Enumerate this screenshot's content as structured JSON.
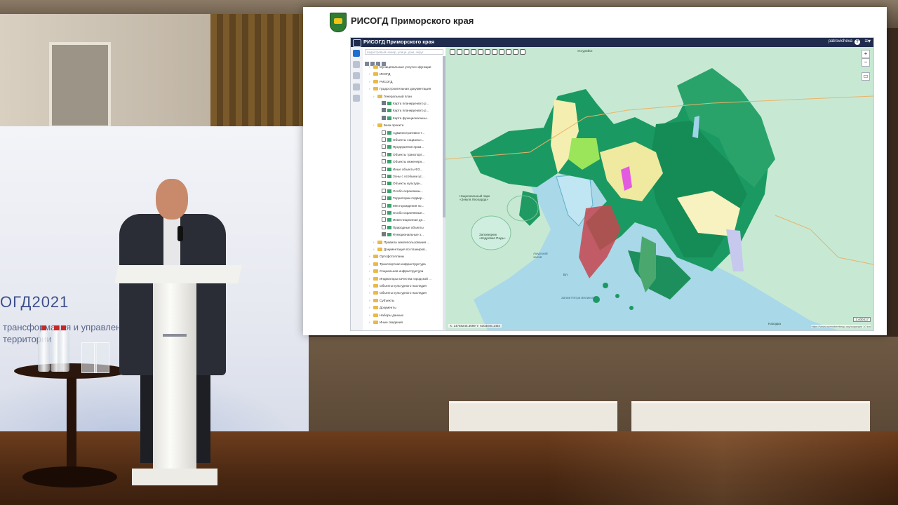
{
  "banner": {
    "title": "ОГД2021",
    "subtitle_line1": "трансформация и управление",
    "subtitle_line2": "территории"
  },
  "presentation": {
    "header_title": "РИСОГД Приморского края"
  },
  "app": {
    "title": "РИСОГД Приморского края",
    "user": "patrovicheva",
    "help_icon": "help-icon",
    "menu_label": "≡▾"
  },
  "tree": {
    "search_placeholder": "кадастровый номер, улица, дом, округ",
    "rows": [
      {
        "label": "Муниципальные услуги и функции",
        "type": "folder"
      },
      {
        "label": "ИСОГД",
        "type": "folder"
      },
      {
        "label": "РИСОГД",
        "type": "folder"
      },
      {
        "label": "Градостроительная документация",
        "type": "folder"
      },
      {
        "label": "Генеральный план",
        "type": "folder"
      },
      {
        "label": "Карта планируемого р...",
        "type": "layer",
        "checked": true
      },
      {
        "label": "Карта планируемого р...",
        "type": "layer",
        "checked": true
      },
      {
        "label": "Карта функциональны...",
        "type": "layer",
        "checked": true
      },
      {
        "label": "База проекта",
        "type": "folder"
      },
      {
        "label": "Административно-т...",
        "type": "layer",
        "checked": false
      },
      {
        "label": "Объекты социальн...",
        "type": "layer",
        "checked": false
      },
      {
        "label": "Предприятия пром...",
        "type": "layer",
        "checked": false
      },
      {
        "label": "Объекты транспорт...",
        "type": "layer",
        "checked": false
      },
      {
        "label": "Объекты инженерн...",
        "type": "layer",
        "checked": false
      },
      {
        "label": "Иные объекты ФЗ...",
        "type": "layer",
        "checked": false
      },
      {
        "label": "Зоны с особыми ус...",
        "type": "layer",
        "checked": false
      },
      {
        "label": "Объекты культурн...",
        "type": "layer",
        "checked": false
      },
      {
        "label": "Особо охраняемы...",
        "type": "layer",
        "checked": false
      },
      {
        "label": "Территории подвер...",
        "type": "layer",
        "checked": false
      },
      {
        "label": "Месторождения по...",
        "type": "layer",
        "checked": false
      },
      {
        "label": "Особо охраняемые...",
        "type": "layer",
        "checked": false
      },
      {
        "label": "Инвестиционная де...",
        "type": "layer",
        "checked": false
      },
      {
        "label": "Природные объекты",
        "type": "layer",
        "checked": false
      },
      {
        "label": "Функциональные з...",
        "type": "layer",
        "checked": true
      },
      {
        "label": "Правила землепользования ...",
        "type": "folder"
      },
      {
        "label": "Документация по планиров...",
        "type": "folder"
      },
      {
        "label": "Ортофотопланы",
        "type": "folder"
      },
      {
        "label": "Транспортная инфраструктура",
        "type": "folder"
      },
      {
        "label": "Социальная инфраструктура",
        "type": "folder"
      },
      {
        "label": "Индикаторы качества городской ...",
        "type": "folder"
      },
      {
        "label": "Объекты культурного наследия",
        "type": "folder"
      },
      {
        "label": "Объекты культурного наследия",
        "type": "folder"
      },
      {
        "label": "Субъекты",
        "type": "folder"
      },
      {
        "label": "Документы",
        "type": "folder"
      },
      {
        "label": "Наборы данных",
        "type": "folder"
      },
      {
        "label": "Иные сведения",
        "type": "folder"
      }
    ]
  },
  "map": {
    "zoom_in": "+",
    "zoom_out": "−",
    "labels": {
      "ussuriysk": "Уссурийск",
      "park": "Национальный парк «Земля Леопарда»",
      "reserve": "Заповедник «Кедровая Падь»",
      "amur_bay": "Амурский залив",
      "peter_bay": "Залив Петра Великого",
      "nakhodka": "Находка",
      "vl": "Вл"
    },
    "coords_x": "X: 14768245.3699",
    "coords_y": "Y: 5303046.1484",
    "scale": "1:400417",
    "scale_km": "10 km",
    "attribution": "https://www.openstreetmap.org/copyright"
  }
}
